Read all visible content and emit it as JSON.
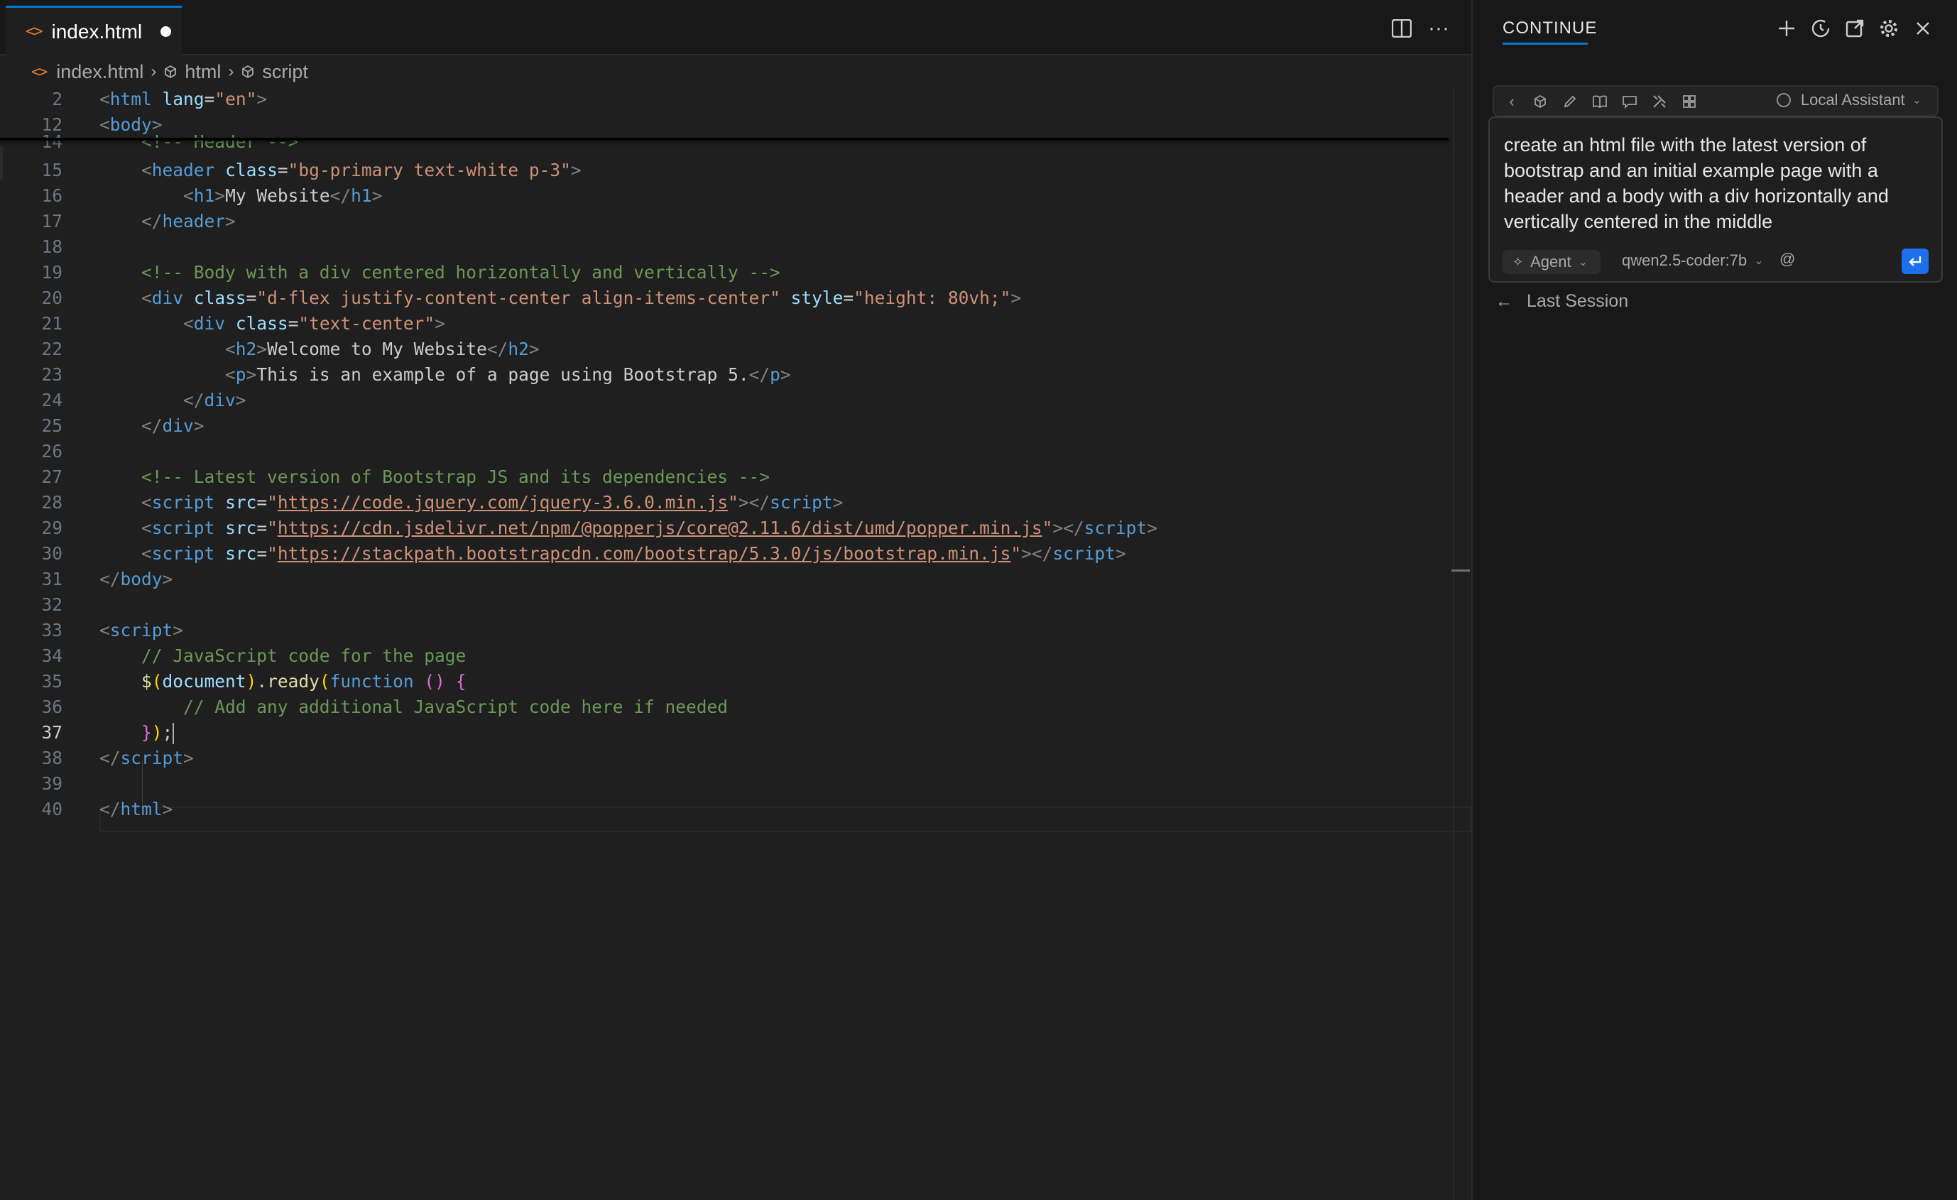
{
  "editor": {
    "tab": {
      "icon": "html-file-icon",
      "title": "index.html"
    },
    "breadcrumb": {
      "file": "index.html",
      "node1": "html",
      "node2": "script"
    },
    "active_line": "37",
    "lines": [
      {
        "n": "2"
      },
      {
        "n": "12"
      },
      {
        "n": "14"
      },
      {
        "n": "15"
      },
      {
        "n": "16",
        "text": "My Website"
      },
      {
        "n": "17"
      },
      {
        "n": "18"
      },
      {
        "n": "19"
      },
      {
        "n": "20"
      },
      {
        "n": "21"
      },
      {
        "n": "22",
        "text": "Welcome to My Website"
      },
      {
        "n": "23",
        "text": "This is an example of a page using Bootstrap 5."
      },
      {
        "n": "24"
      },
      {
        "n": "25"
      },
      {
        "n": "26"
      },
      {
        "n": "27"
      },
      {
        "n": "28",
        "url": "https://code.jquery.com/jquery-3.6.0.min.js"
      },
      {
        "n": "29",
        "url": "https://cdn.jsdelivr.net/npm/@popperjs/core@2.11.6/dist/umd/popper.min.js"
      },
      {
        "n": "30",
        "url": "https://stackpath.bootstrapcdn.com/bootstrap/5.3.0/js/bootstrap.min.js"
      },
      {
        "n": "31"
      },
      {
        "n": "32"
      },
      {
        "n": "33"
      },
      {
        "n": "34"
      },
      {
        "n": "35"
      },
      {
        "n": "36"
      },
      {
        "n": "37"
      },
      {
        "n": "38"
      },
      {
        "n": "39"
      },
      {
        "n": "40"
      }
    ]
  },
  "panel": {
    "title": "CONTINUE",
    "mode_bar": {
      "assistant": "Local Assistant"
    },
    "input": {
      "text": "create an html file with the latest version of bootstrap and an initial example page with a header and a body with a div horizontally and vertically centered in the middle",
      "mode": "Agent",
      "model": "qwen2.5-coder:7b",
      "at": "@"
    },
    "last_session": "Last Session"
  },
  "colors": {
    "accent": "#0078d4",
    "send": "#1f6feb",
    "tab_dirty_dot": "#ffffff"
  }
}
